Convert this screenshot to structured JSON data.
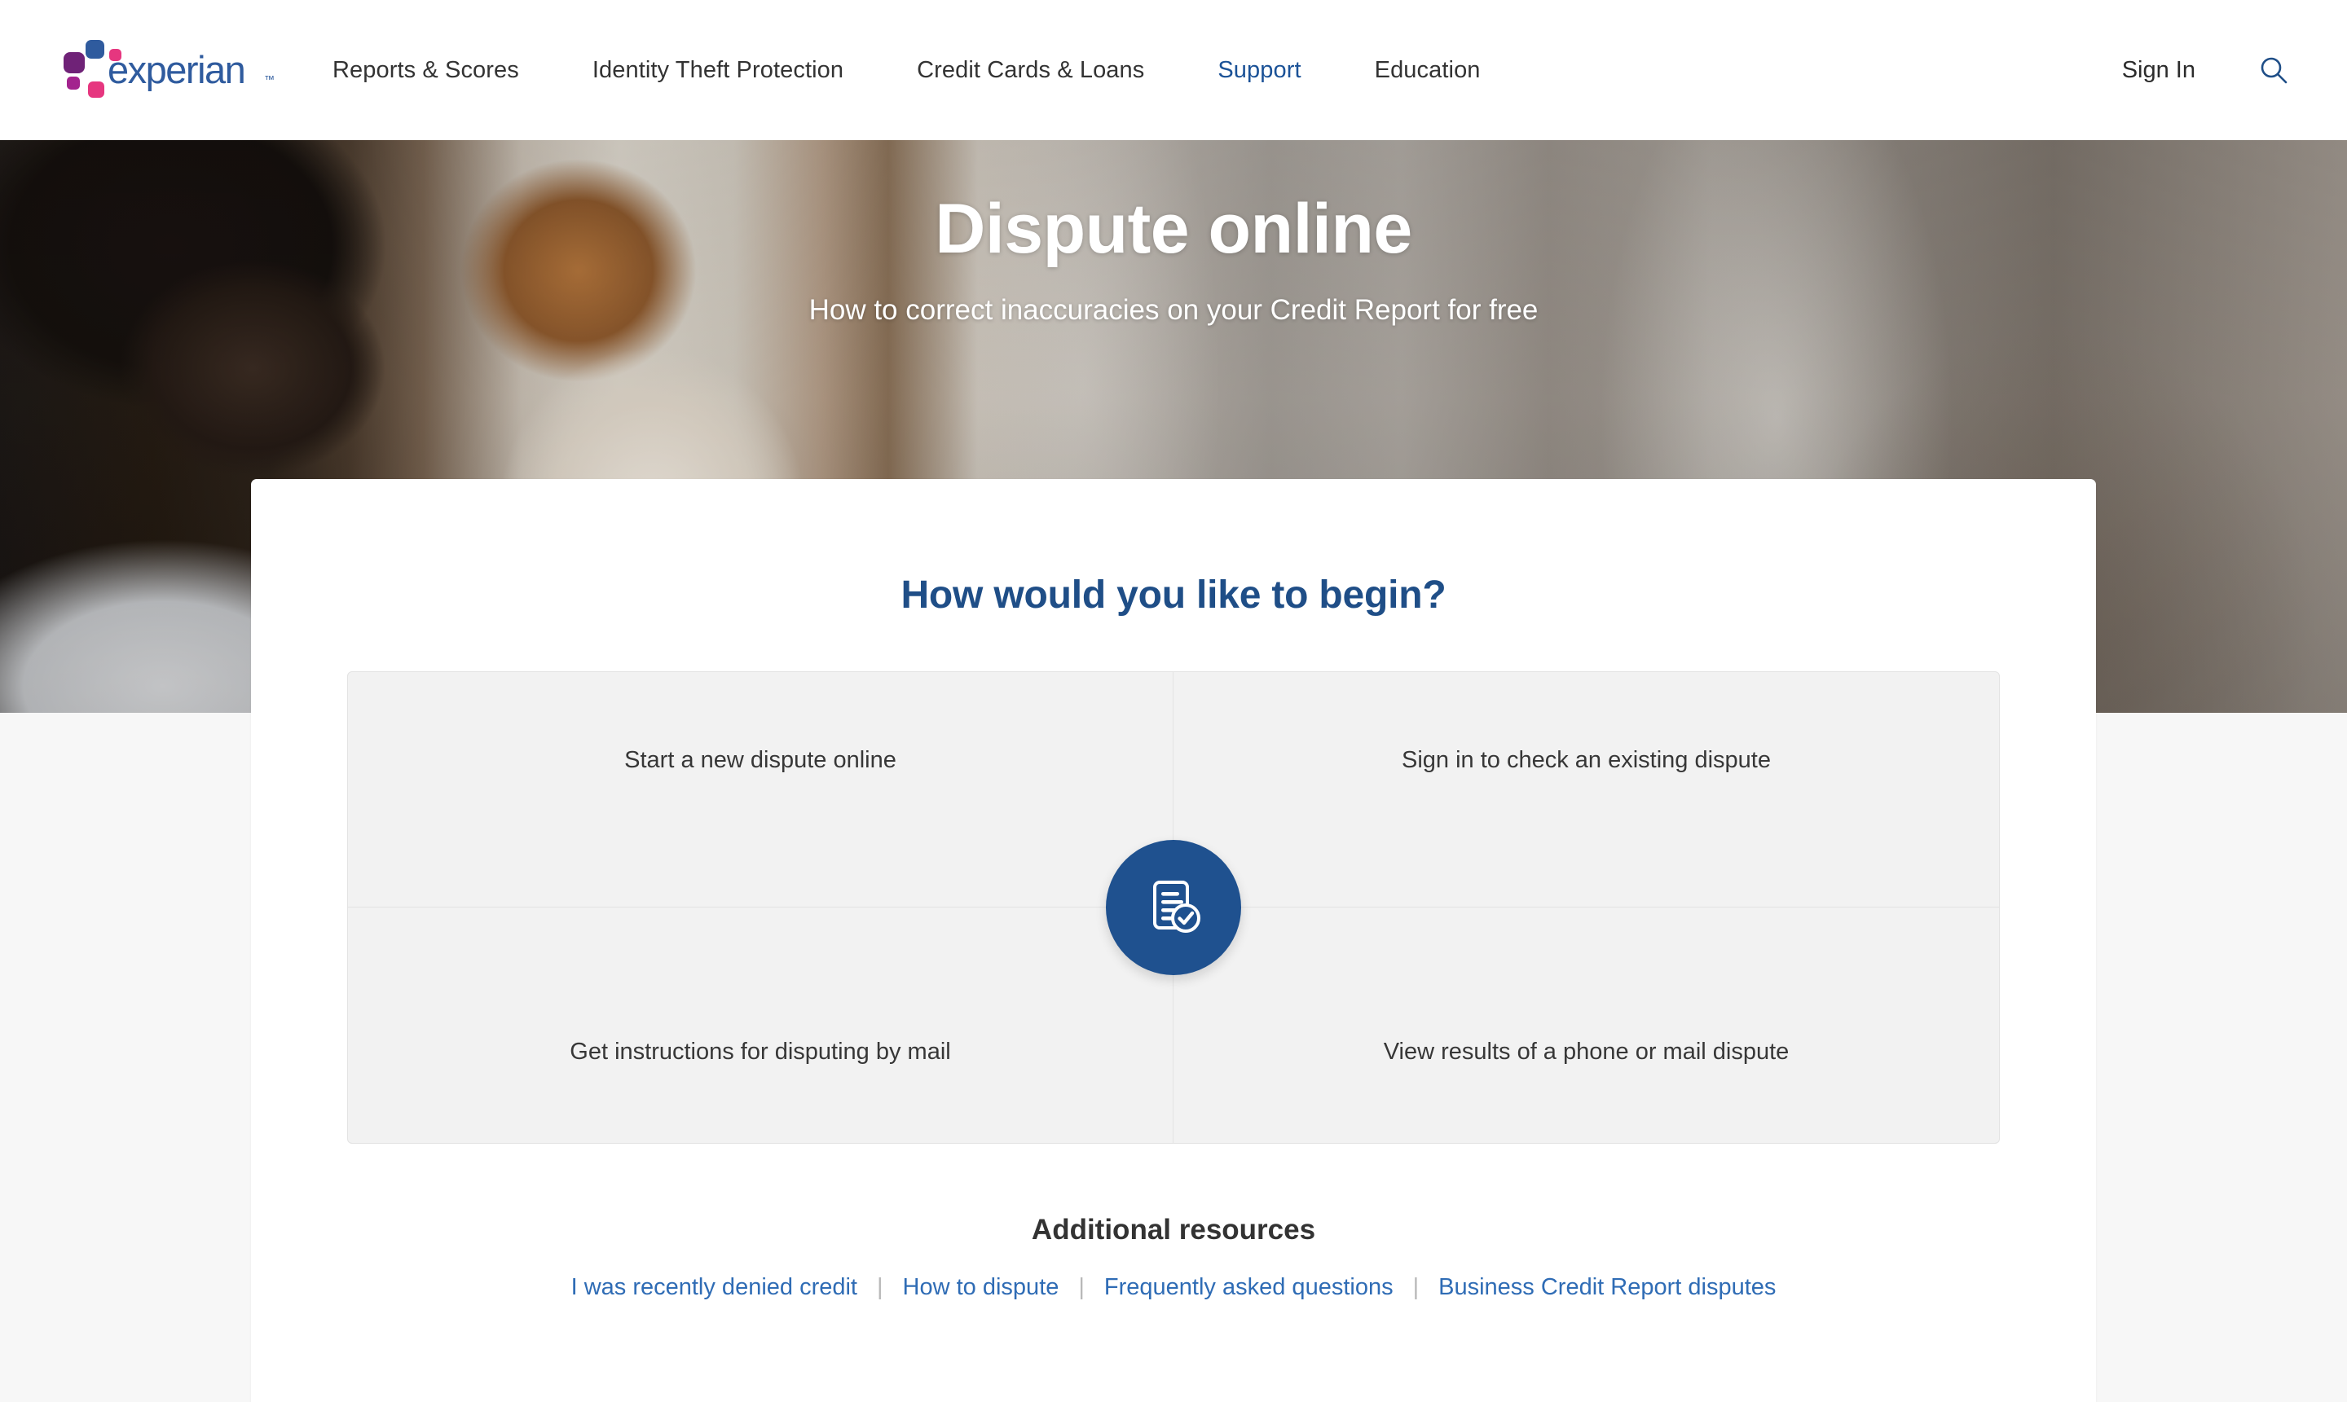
{
  "header": {
    "logo_alt": "experian",
    "logo_wordmark": "experian",
    "logo_tm": "™",
    "nav_items": [
      {
        "label": "Reports & Scores",
        "active": false
      },
      {
        "label": "Identity Theft Protection",
        "active": false
      },
      {
        "label": "Credit Cards & Loans",
        "active": false
      },
      {
        "label": "Support",
        "active": true
      },
      {
        "label": "Education",
        "active": false
      }
    ],
    "sign_in_label": "Sign In",
    "search_icon": "search-icon"
  },
  "hero": {
    "title": "Dispute online",
    "subtitle": "How to correct inaccuracies on your Credit Report for free"
  },
  "card": {
    "heading": "How would you like to begin?",
    "options": [
      {
        "label": "Start a new dispute online"
      },
      {
        "label": "Sign in to check an existing dispute"
      },
      {
        "label": "Get instructions for disputing by mail"
      },
      {
        "label": "View results of a phone or mail dispute"
      }
    ],
    "center_icon": "document-check-icon"
  },
  "resources": {
    "title": "Additional resources",
    "separator": "|",
    "links": [
      {
        "label": "I was recently denied credit"
      },
      {
        "label": "How to dispute"
      },
      {
        "label": "Frequently asked questions"
      },
      {
        "label": "Business Credit Report disputes"
      }
    ]
  },
  "colors": {
    "brand_blue": "#1f4e87",
    "logo_blue": "#2f5b9e",
    "logo_pink": "#e6367f",
    "logo_purple": "#6f2277",
    "link_blue": "#2f6cb5",
    "nav_active": "#1b5297",
    "badge_blue": "#1f518f",
    "page_bg": "#f7f7f7",
    "quad_bg": "#f2f2f2"
  }
}
